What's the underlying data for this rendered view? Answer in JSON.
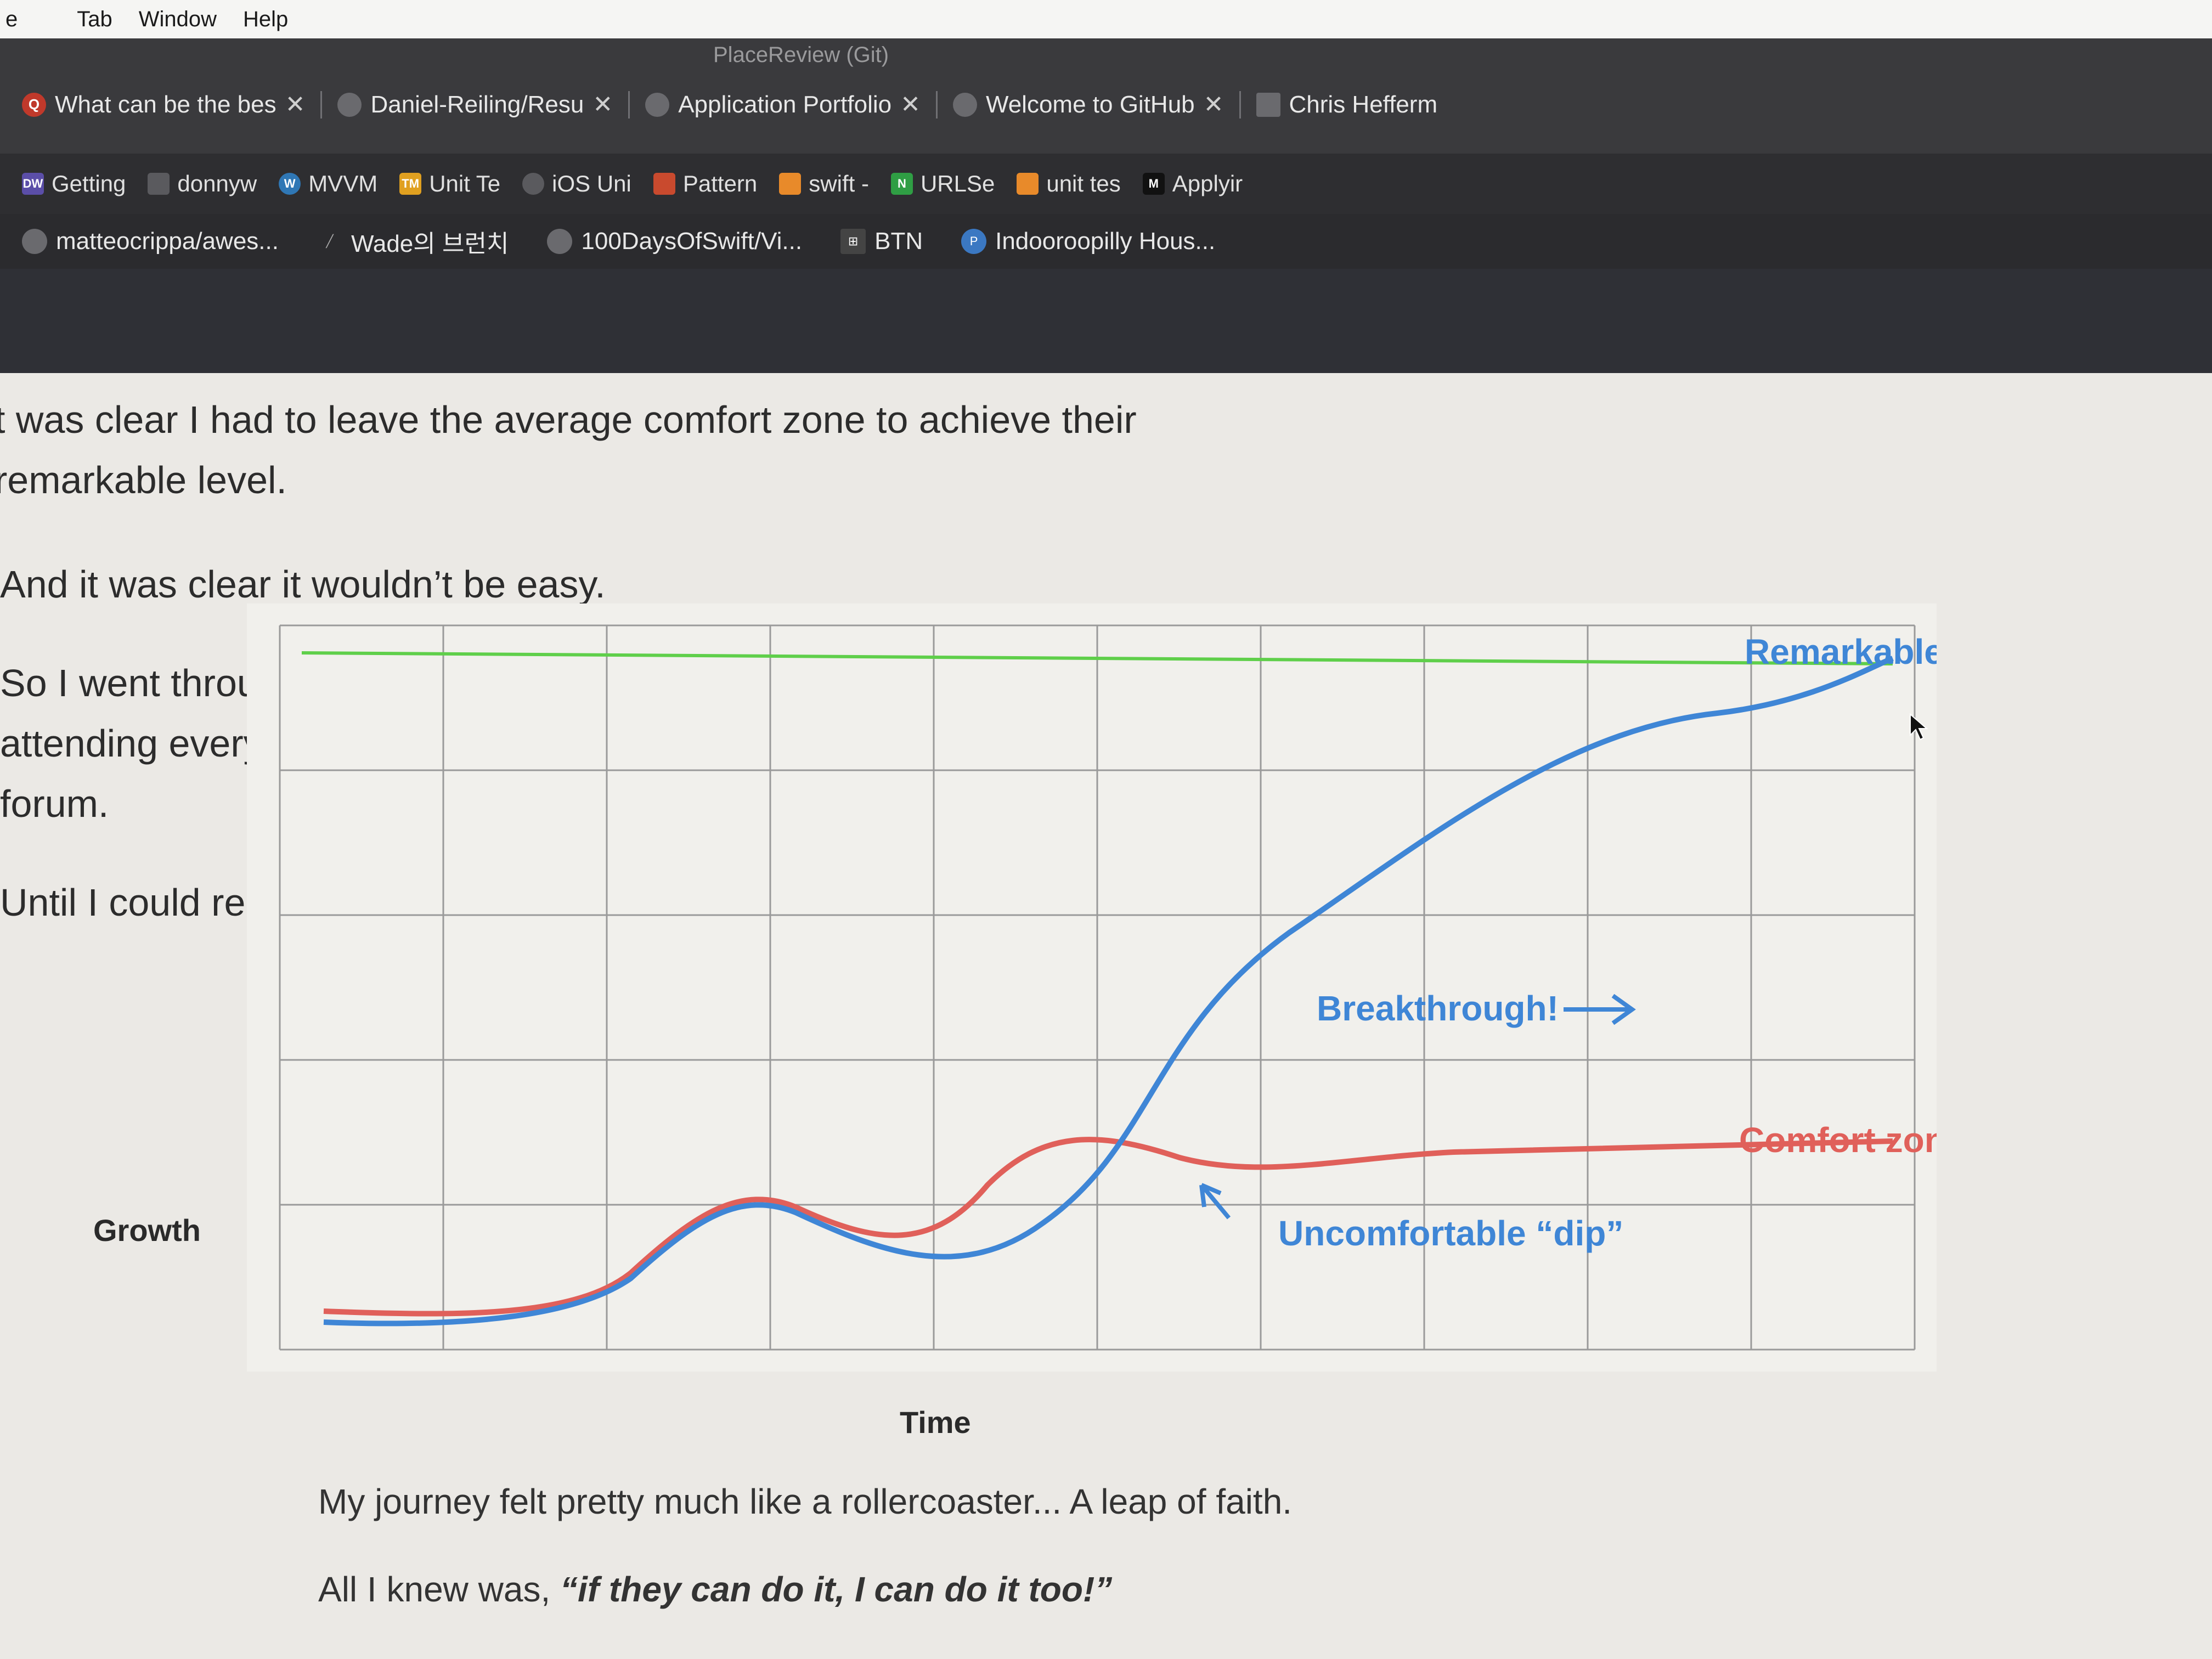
{
  "menubar": {
    "items": [
      "e",
      "Tab",
      "Window",
      "Help"
    ]
  },
  "window": {
    "title": "PlaceReview (Git)"
  },
  "tabs": [
    {
      "label": "What can be the bes",
      "icon": "quora-icon",
      "closable": true
    },
    {
      "label": "Daniel-Reiling/Resu",
      "icon": "github-icon",
      "closable": true
    },
    {
      "label": "Application Portfolio",
      "icon": "globe-icon",
      "closable": true
    },
    {
      "label": "PlaceReview (Git)",
      "icon": "folder-icon",
      "closable": false
    },
    {
      "label": "Welcome to GitHub",
      "icon": "globe-icon",
      "closable": true
    },
    {
      "label": "Chris Hefferm",
      "icon": "page-icon",
      "closable": false
    }
  ],
  "bookmarks": [
    {
      "label": "Getting",
      "icon": "dw-icon"
    },
    {
      "label": "donnyw",
      "icon": "page-icon"
    },
    {
      "label": "MVVM",
      "icon": "wordpress-icon"
    },
    {
      "label": "Unit Te",
      "icon": "tm-icon"
    },
    {
      "label": "iOS Uni",
      "icon": "globe-icon"
    },
    {
      "label": "Pattern",
      "icon": "bird-icon"
    },
    {
      "label": "swift -",
      "icon": "stack-icon"
    },
    {
      "label": "URLSe",
      "icon": "n-icon"
    },
    {
      "label": "unit tes",
      "icon": "stack-icon"
    },
    {
      "label": "Applyir",
      "icon": "medium-icon"
    }
  ],
  "extensions": [
    {
      "label": "matteocrippa/awes...",
      "icon": "github-icon"
    },
    {
      "label": "Wade의 브런치",
      "icon": "pen-icon"
    },
    {
      "label": "100DaysOfSwift/Vi...",
      "icon": "github-icon"
    },
    {
      "label": "BTN",
      "icon": "btn-icon"
    },
    {
      "label": "Indooroopilly Hous...",
      "icon": "p-icon"
    }
  ],
  "article": {
    "p1_line1": "t was clear I had to leave the average comfort zone to achieve their",
    "p1_line2": "remarkable level.",
    "p2": "And it was clear it wouldn’t be easy.",
    "p3_line1": "So I went through the uncomfortable dip by reading every possible book and",
    "p3_line2": "attending every possible conference, course, meeting group, and online",
    "p3_line3": "forum.",
    "p4": "Until I could reach my career breakthrough.",
    "caption1": "My journey felt pretty much like a rollercoaster... A leap of faith.",
    "caption2_prefix": "All I knew was, ",
    "caption2_quote": "“if they can do it, I can do it too!”"
  },
  "chart_data": {
    "type": "line",
    "xlabel": "Time",
    "ylabel": "Growth",
    "grid": true,
    "series": [
      {
        "name": "Remarkable",
        "color": "#4a90d9",
        "shape": "dip then steep rise to plateau"
      },
      {
        "name": "Comfort zone",
        "color": "#e0605a",
        "shape": "small wave then flat"
      },
      {
        "name": "",
        "color": "#5fcf4a",
        "shape": "flat top line"
      }
    ],
    "annotations": [
      "Remarkable",
      "Breakthrough!",
      "Comfort zone",
      "Uncomfortable “dip”"
    ]
  }
}
